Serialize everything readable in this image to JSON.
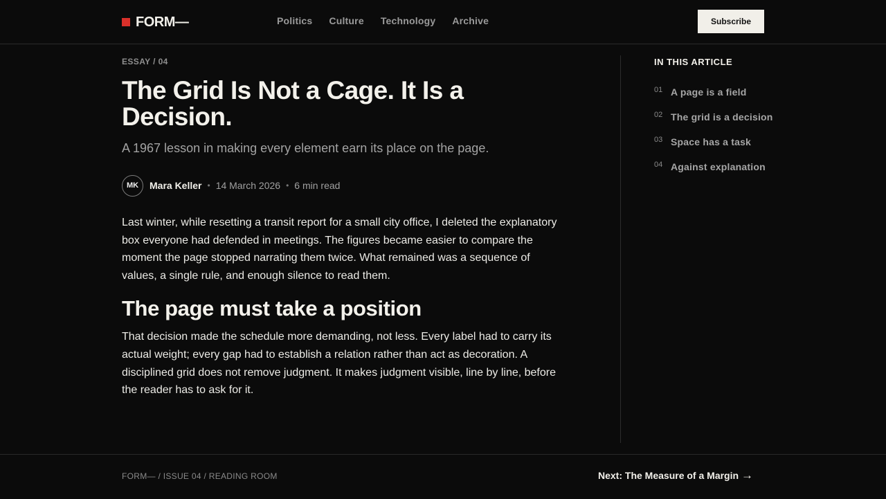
{
  "header": {
    "logo": "FORM—",
    "nav": [
      "Politics",
      "Culture",
      "Technology",
      "Archive"
    ],
    "subscribe": "Subscribe"
  },
  "article": {
    "kicker": "ESSAY / 04",
    "title": "The Grid Is Not a Cage. It Is a Decision.",
    "subtitle": "A 1967 lesson in making every element earn its place on the page.",
    "avatar_initials": "MK",
    "author": "Mara Keller",
    "date": "14 March 2026",
    "read_time": "6 min read",
    "separator": "•",
    "paragraph1": "Last winter, while resetting a transit report for a small city office, I deleted the explanatory box everyone had defended in meetings. The figures became easier to compare the moment the page stopped narrating them twice. What remained was a sequence of values, a single rule, and enough silence to read them.",
    "heading2": "The page must take a position",
    "paragraph2": "That decision made the schedule more demanding, not less. Every label had to carry its actual weight; every gap had to establish a relation rather than act as decoration. A disciplined grid does not remove judgment. It makes judgment visible, line by line, before the reader has to ask for it."
  },
  "toc": {
    "title": "IN THIS ARTICLE",
    "items": [
      {
        "num": "01",
        "label": "A page is a field"
      },
      {
        "num": "02",
        "label": "The grid is a decision"
      },
      {
        "num": "03",
        "label": "Space has a task"
      },
      {
        "num": "04",
        "label": "Against explanation"
      }
    ]
  },
  "footer": {
    "breadcrumb": "FORM— / ISSUE 04 / READING ROOM",
    "next": "Next: The Measure of a Margin",
    "arrow": "→"
  },
  "colors": {
    "background": "#0b0b0b",
    "accent": "#d9302a",
    "text": "#eceae4",
    "muted": "#a0a0a0"
  }
}
